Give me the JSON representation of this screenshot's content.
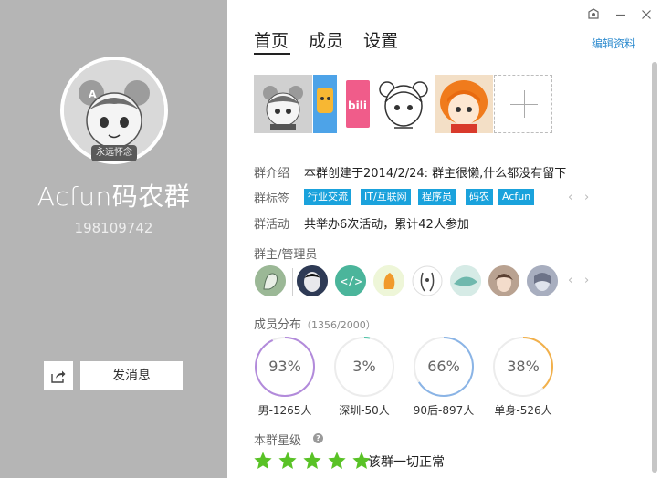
{
  "group": {
    "name": "Acfun码农群",
    "number": "198109742",
    "avatar_badge": "永远怀念"
  },
  "actions": {
    "share_icon": "share-icon",
    "send_message": "发消息"
  },
  "tabs": [
    "首页",
    "成员",
    "设置"
  ],
  "edit_profile": "编辑资料",
  "photos": {
    "items": [
      "acfun-mascot",
      "acfun-logo",
      "bilibili-logo",
      "anime-sketch",
      "anime-girl-orange"
    ],
    "add_icon": "plus-icon"
  },
  "info": {
    "intro_label": "群介绍",
    "intro_value": "本群创建于2014/2/24:  群主很懒,什么都没有留下",
    "tags_label": "群标签",
    "tags": [
      "行业交流",
      "IT/互联网",
      "程序员",
      "码农",
      "Acfun"
    ],
    "activity_label": "群活动",
    "activity_value": "共举办6次活动，累计42人参加"
  },
  "admins": {
    "title": "群主/管理员",
    "count": 8
  },
  "members": {
    "title": "成员分布",
    "count": "（1356/2000）",
    "stats": [
      {
        "percent": 93,
        "text": "93%",
        "label": "男-1265人",
        "color": "#b28adb"
      },
      {
        "percent": 3,
        "text": "3%",
        "label": "深圳-50人",
        "color": "#4cc2a6"
      },
      {
        "percent": 66,
        "text": "66%",
        "label": "90后-897人",
        "color": "#8ab4e6"
      },
      {
        "percent": 38,
        "text": "38%",
        "label": "单身-526人",
        "color": "#f2b04a"
      }
    ]
  },
  "rating": {
    "title": "本群星级",
    "stars": 5,
    "text": "该群一切正常",
    "color": "#59c226"
  }
}
